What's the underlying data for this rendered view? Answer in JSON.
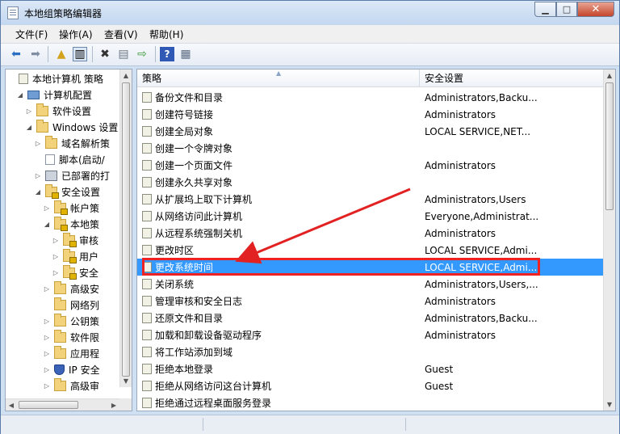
{
  "window": {
    "title": "本地组策略编辑器"
  },
  "menu": [
    "文件(F)",
    "操作(A)",
    "查看(V)",
    "帮助(H)"
  ],
  "tree": [
    {
      "label": "本地计算机 策略",
      "icon": "policy-icon",
      "depth": 0,
      "caret": ""
    },
    {
      "label": "计算机配置",
      "icon": "computer-icon",
      "depth": 1,
      "caret": "expanded"
    },
    {
      "label": "软件设置",
      "icon": "folder-icon",
      "depth": 2,
      "caret": "collapsed"
    },
    {
      "label": "Windows 设置",
      "icon": "folder-icon",
      "depth": 2,
      "caret": "expanded"
    },
    {
      "label": "域名解析策",
      "icon": "folder-icon",
      "depth": 3,
      "caret": "collapsed"
    },
    {
      "label": "脚本(启动/",
      "icon": "script-icon",
      "depth": 3,
      "caret": ""
    },
    {
      "label": "已部署的打",
      "icon": "printer-icon",
      "depth": 3,
      "caret": "collapsed"
    },
    {
      "label": "安全设置",
      "icon": "lock-folder-icon",
      "depth": 3,
      "caret": "expanded"
    },
    {
      "label": "帐户策",
      "icon": "lock-folder-icon",
      "depth": 4,
      "caret": "collapsed"
    },
    {
      "label": "本地策",
      "icon": "lock-folder-icon",
      "depth": 4,
      "caret": "expanded"
    },
    {
      "label": "审核",
      "icon": "lock-folder-icon",
      "depth": 5,
      "caret": "collapsed"
    },
    {
      "label": "用户",
      "icon": "lock-folder-icon",
      "depth": 5,
      "caret": "collapsed"
    },
    {
      "label": "安全",
      "icon": "lock-folder-icon",
      "depth": 5,
      "caret": "collapsed"
    },
    {
      "label": "高级安",
      "icon": "folder-icon",
      "depth": 4,
      "caret": "collapsed"
    },
    {
      "label": "网络列",
      "icon": "folder-icon",
      "depth": 4,
      "caret": ""
    },
    {
      "label": "公钥策",
      "icon": "folder-icon",
      "depth": 4,
      "caret": "collapsed"
    },
    {
      "label": "软件限",
      "icon": "folder-icon",
      "depth": 4,
      "caret": "collapsed"
    },
    {
      "label": "应用程",
      "icon": "folder-icon",
      "depth": 4,
      "caret": "collapsed"
    },
    {
      "label": "IP 安全",
      "icon": "ip-security-icon",
      "depth": 4,
      "caret": "collapsed"
    },
    {
      "label": "高级审",
      "icon": "folder-icon",
      "depth": 4,
      "caret": "collapsed"
    }
  ],
  "columns": {
    "policy": "策略",
    "setting": "安全设置"
  },
  "rows": [
    {
      "policy": "备份文件和目录",
      "setting": "Administrators,Backu..."
    },
    {
      "policy": "创建符号链接",
      "setting": "Administrators"
    },
    {
      "policy": "创建全局对象",
      "setting": "LOCAL SERVICE,NET..."
    },
    {
      "policy": "创建一个令牌对象",
      "setting": ""
    },
    {
      "policy": "创建一个页面文件",
      "setting": "Administrators"
    },
    {
      "policy": "创建永久共享对象",
      "setting": ""
    },
    {
      "policy": "从扩展坞上取下计算机",
      "setting": "Administrators,Users"
    },
    {
      "policy": "从网络访问此计算机",
      "setting": "Everyone,Administrat..."
    },
    {
      "policy": "从远程系统强制关机",
      "setting": "Administrators"
    },
    {
      "policy": "更改时区",
      "setting": "LOCAL SERVICE,Admi..."
    },
    {
      "policy": "更改系统时间",
      "setting": "LOCAL SERVICE,Admi...",
      "selected": true
    },
    {
      "policy": "关闭系统",
      "setting": "Administrators,Users,..."
    },
    {
      "policy": "管理审核和安全日志",
      "setting": "Administrators"
    },
    {
      "policy": "还原文件和目录",
      "setting": "Administrators,Backu..."
    },
    {
      "policy": "加载和卸载设备驱动程序",
      "setting": "Administrators"
    },
    {
      "policy": "将工作站添加到域",
      "setting": ""
    },
    {
      "policy": "拒绝本地登录",
      "setting": "Guest"
    },
    {
      "policy": "拒绝从网络访问这台计算机",
      "setting": "Guest"
    },
    {
      "policy": "拒绝通过远程桌面服务登录",
      "setting": ""
    }
  ],
  "colors": {
    "selection": "#3399ff",
    "annotation": "#e22222"
  }
}
